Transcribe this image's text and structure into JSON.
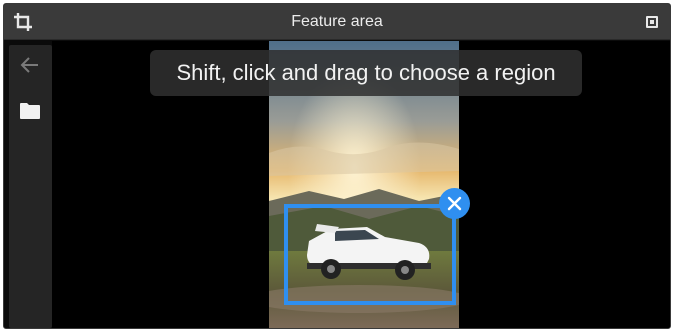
{
  "window": {
    "title": "Feature area",
    "icons": {
      "crop": "crop-icon",
      "maximize": "maximize-icon"
    }
  },
  "sidebar": {
    "items": [
      {
        "icon": "arrow-left-icon"
      },
      {
        "icon": "folder-icon"
      }
    ]
  },
  "canvas": {
    "hint": "Shift, click and drag to choose a region",
    "image": "car-in-mountains-photo",
    "selection": {
      "close_icon": "close-icon"
    }
  },
  "colors": {
    "accent": "#2f8ff0",
    "titlebar": "#3a3a3a",
    "sidebar": "#252525",
    "canvas": "#000000"
  }
}
